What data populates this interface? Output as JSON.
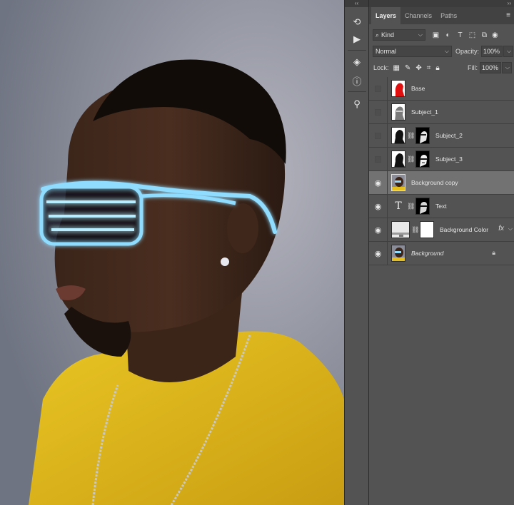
{
  "panel": {
    "tabs": [
      {
        "label": "Layers",
        "active": true
      },
      {
        "label": "Channels",
        "active": false
      },
      {
        "label": "Paths",
        "active": false
      }
    ],
    "filter": {
      "kind_label": "Kind"
    },
    "blend_mode": "Normal",
    "opacity": {
      "label": "Opacity:",
      "value": "100%"
    },
    "lock_label": "Lock:",
    "fill": {
      "label": "Fill:",
      "value": "100%"
    }
  },
  "layers": [
    {
      "name": "Base",
      "visible": false,
      "selected": false
    },
    {
      "name": "Subject_1",
      "visible": false,
      "selected": false
    },
    {
      "name": "Subject_2",
      "visible": false,
      "selected": false
    },
    {
      "name": "Subject_3",
      "visible": false,
      "selected": false
    },
    {
      "name": "Background copy",
      "visible": true,
      "selected": true
    },
    {
      "name": "Text",
      "visible": true,
      "selected": false
    },
    {
      "name": "Background Color",
      "visible": true,
      "selected": false
    },
    {
      "name": "Background",
      "visible": true,
      "selected": false,
      "locked": true
    }
  ],
  "icons": {
    "collapse": "double-chevron-icon",
    "tools": [
      "history-icon",
      "play-actions-icon",
      "3d-cube-icon",
      "info-icon",
      "clone-source-icon"
    ]
  },
  "colors": {
    "panel_bg": "#535353",
    "selected_row": "#727272",
    "shirt": "#e4bf1e",
    "glasses_glow": "#7fd3ff",
    "base_thumb_red": "#e01010"
  }
}
